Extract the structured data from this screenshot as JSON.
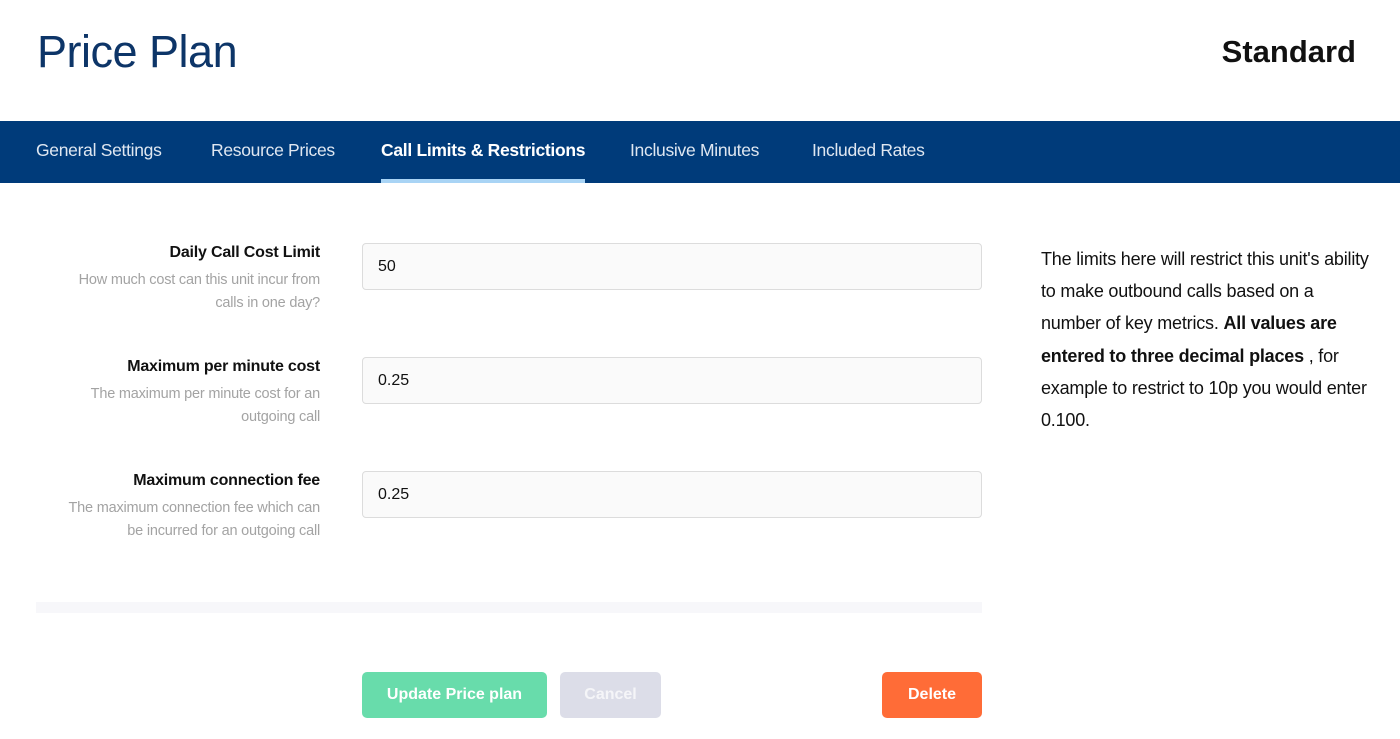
{
  "header": {
    "title": "Price Plan",
    "plan_name": "Standard"
  },
  "tabs": [
    {
      "label": "General Settings",
      "active": false
    },
    {
      "label": "Resource Prices",
      "active": false
    },
    {
      "label": "Call Limits & Restrictions",
      "active": true
    },
    {
      "label": "Inclusive Minutes",
      "active": false
    },
    {
      "label": "Included Rates",
      "active": false
    }
  ],
  "form": {
    "fields": [
      {
        "label": "Daily Call Cost Limit",
        "help_line1": "How much cost can this unit incur from",
        "help_line2": "calls in one day?",
        "value": "50"
      },
      {
        "label": "Maximum per minute cost",
        "help_line1": "The maximum per minute cost for an",
        "help_line2": "outgoing call",
        "value": "0.25"
      },
      {
        "label": "Maximum connection fee",
        "help_line1": "The maximum connection fee which can",
        "help_line2": "be incurred for an outgoing call",
        "value": "0.25"
      }
    ]
  },
  "info": {
    "text_before": "The limits here will restrict this unit's ability to make outbound calls based on a number of key metrics. ",
    "text_bold": "All values are entered to three decimal places",
    "text_after": " , for example to restrict to 10p you would enter 0.100."
  },
  "actions": {
    "update_label": "Update Price plan",
    "cancel_label": "Cancel",
    "delete_label": "Delete"
  },
  "colors": {
    "nav_bg": "#003b7a",
    "title": "#0d3568",
    "active_tab_indicator": "#a9d4f5",
    "update_button": "#68dcab",
    "cancel_button": "#dcdde8",
    "delete_button": "#ff6c37"
  }
}
